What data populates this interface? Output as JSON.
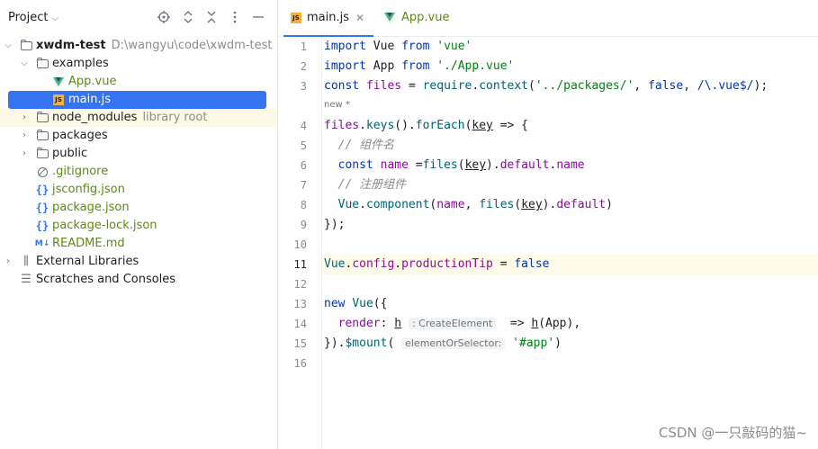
{
  "sidebar": {
    "title": "Project",
    "header_icons": [
      "locate-icon",
      "expand-collapse-icon",
      "close-tree-icon",
      "more-icon",
      "minimize-icon"
    ],
    "tree": [
      {
        "label": "xwdm-test",
        "hint": "D:\\wangyu\\code\\xwdm-test",
        "icon": "folder-icon",
        "expanded": true
      },
      {
        "label": "examples",
        "icon": "folder-icon",
        "expanded": true
      },
      {
        "label": "App.vue",
        "icon": "vue-icon"
      },
      {
        "label": "main.js",
        "icon": "js-icon",
        "selected": true
      },
      {
        "label": "node_modules",
        "hint": "library root",
        "icon": "folder-icon",
        "expanded": false
      },
      {
        "label": "packages",
        "icon": "folder-icon",
        "expanded": false
      },
      {
        "label": "public",
        "icon": "folder-icon",
        "expanded": false
      },
      {
        "label": ".gitignore",
        "icon": "ignore-icon"
      },
      {
        "label": "jsconfig.json",
        "icon": "json-icon"
      },
      {
        "label": "package.json",
        "icon": "json-icon"
      },
      {
        "label": "package-lock.json",
        "icon": "json-icon"
      },
      {
        "label": "README.md",
        "icon": "markdown-icon"
      },
      {
        "label": "External Libraries",
        "icon": "library-icon"
      },
      {
        "label": "Scratches and Consoles",
        "icon": "scratches-icon"
      }
    ]
  },
  "editor": {
    "tabs": [
      {
        "label": "main.js",
        "icon": "js-icon",
        "active": true,
        "close": "✕"
      },
      {
        "label": "App.vue",
        "icon": "vue-icon",
        "active": false
      }
    ],
    "new_marker": "new *",
    "current_line": 11,
    "line_numbers": [
      "1",
      "2",
      "3",
      "4",
      "5",
      "6",
      "7",
      "8",
      "9",
      "10",
      "11",
      "12",
      "13",
      "14",
      "15",
      "16"
    ],
    "lines": {
      "l1": [
        "import",
        "Vue",
        "from",
        "'vue'"
      ],
      "l2": [
        "import",
        "App",
        "from",
        "'./App.vue'"
      ],
      "l3": [
        "const",
        "files",
        "=",
        "require",
        "context",
        "'../packages/'",
        "false",
        "/\\.vue$/"
      ],
      "l4": [
        "files",
        "keys",
        "forEach",
        "key",
        "=> {"
      ],
      "l5": "// 组件名",
      "l6": [
        "const",
        "name",
        "files",
        "key",
        "default",
        "name"
      ],
      "l7": "// 注册组件",
      "l8": [
        "Vue",
        "component",
        "name",
        "files",
        "key",
        "default"
      ],
      "l9": "});",
      "l11": [
        "Vue",
        "config",
        "productionTip",
        "=",
        "false"
      ],
      "l13": [
        "new",
        "Vue",
        "({"
      ],
      "l14": [
        "render",
        "h",
        ": CreateElement",
        "=>",
        "h",
        "App"
      ],
      "l15": [
        "$mount",
        "elementOrSelector:",
        "'#app'"
      ]
    }
  },
  "watermark": "CSDN @一只敲码的猫~"
}
